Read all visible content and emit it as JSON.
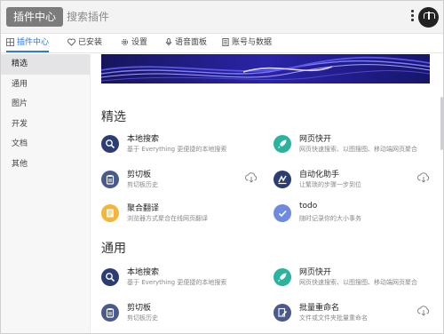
{
  "header": {
    "tab_label": "插件中心",
    "search_placeholder": "搜索插件"
  },
  "tabs": [
    "插件中心",
    "已安装",
    "设置",
    "语音面板",
    "账号与数据"
  ],
  "sidebar": [
    "精选",
    "通用",
    "图片",
    "开发",
    "文档",
    "其他"
  ],
  "sections": [
    {
      "title": "精选",
      "cards": [
        {
          "title": "本地搜索",
          "desc": "基于 Everything 更便捷的本地搜索",
          "icon": "search-icon",
          "color": "#2c3d73"
        },
        {
          "title": "网页快开",
          "desc": "网页快速搜索、以图搜图、移动端网页聚合",
          "icon": "rocket-icon",
          "color": "#2bb3a0"
        },
        {
          "title": "剪切板",
          "desc": "剪切板历史",
          "icon": "clipboard-icon",
          "color": "#4a5a8c"
        },
        {
          "title": "自动化助手",
          "desc": "让繁琐的步骤一步到位",
          "icon": "automation-icon",
          "color": "#2c3d73"
        },
        {
          "title": "聚合翻译",
          "desc": "浏览器方式聚合在线网页翻译",
          "icon": "translate-icon",
          "color": "#f3b63a"
        },
        {
          "title": "todo",
          "desc": "随时记录你的大小事务",
          "icon": "check-icon",
          "color": "#6f8be0"
        }
      ]
    },
    {
      "title": "通用",
      "cards": [
        {
          "title": "本地搜索",
          "desc": "基于 Everything 更便捷的本地搜索",
          "icon": "search-icon",
          "color": "#2c3d73"
        },
        {
          "title": "网页快开",
          "desc": "网页快速搜索、以图搜图、移动端网页聚合",
          "icon": "rocket-icon",
          "color": "#2bb3a0"
        },
        {
          "title": "剪切板",
          "desc": "剪切板历史",
          "icon": "clipboard-icon",
          "color": "#4a5a8c"
        },
        {
          "title": "批量重命名",
          "desc": "文件或文件夹批量重命名",
          "icon": "rename-icon",
          "color": "#4a5a8c"
        }
      ]
    }
  ]
}
